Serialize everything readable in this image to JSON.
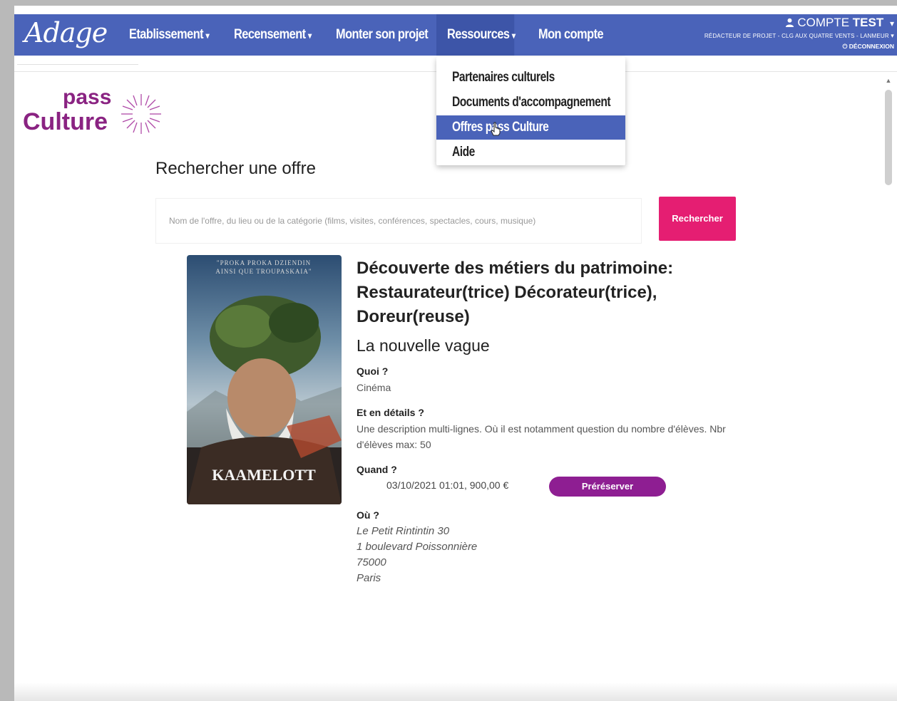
{
  "navbar": {
    "brand": "Adage",
    "items": [
      {
        "label": "Etablissement",
        "caret": "▾"
      },
      {
        "label": "Recensement",
        "caret": "▾"
      },
      {
        "label": "Monter son projet",
        "caret": ""
      },
      {
        "label": "Ressources",
        "caret": "▾"
      },
      {
        "label": "Mon compte",
        "caret": ""
      }
    ],
    "account": {
      "prefix": "COMPTE",
      "name_bold": "TEST",
      "caret": "▾",
      "role": "RÉDACTEUR DE PROJET - CLG AUX QUATRE VENTS - LANMEUR",
      "logout": "DÉCONNEXION"
    }
  },
  "dropdown": {
    "items": [
      {
        "label": "Partenaires culturels"
      },
      {
        "label": "Documents d'accompagnement"
      },
      {
        "label": "Offres pass Culture"
      },
      {
        "label": "Aide"
      }
    ]
  },
  "logo": {
    "pass": "pass",
    "culture": "Culture"
  },
  "search": {
    "title": "Rechercher une offre",
    "placeholder": "Nom de l'offre, du lieu ou de la catégorie (films, visites, conférences, spectacles, cours, musique)",
    "button": "Rechercher"
  },
  "offer": {
    "poster": {
      "top_text_1": "\"PROKA PROKA DZIENDIN",
      "top_text_2": "AINSI QUE TROUPASKAIA\"",
      "logo_text": "KAAMELOTT"
    },
    "title": "Découverte des métiers du patrimoine: Restaurateur(trice) Décorateur(trice), Doreur(reuse)",
    "venue": "La nouvelle vague",
    "what_label": "Quoi ?",
    "what_value": "Cinéma",
    "details_label": "Et en détails ?",
    "details_value": "Une description multi-lignes. Où il est notamment question du nombre d'élèves. Nbr d'élèves max: 50",
    "when_label": "Quand ?",
    "when_value": "03/10/2021 01:01, 900,00 €",
    "prereserve_button": "Préréserver",
    "where_label": "Où ?",
    "address": [
      "Le Petit Rintintin 30",
      "1 boulevard Poissonnière",
      "75000",
      "Paris"
    ]
  },
  "colors": {
    "navbar": "#4a63b9",
    "brand_purple": "#8a2382",
    "search_button": "#e51e72",
    "prereserve_button": "#8e1e92"
  }
}
